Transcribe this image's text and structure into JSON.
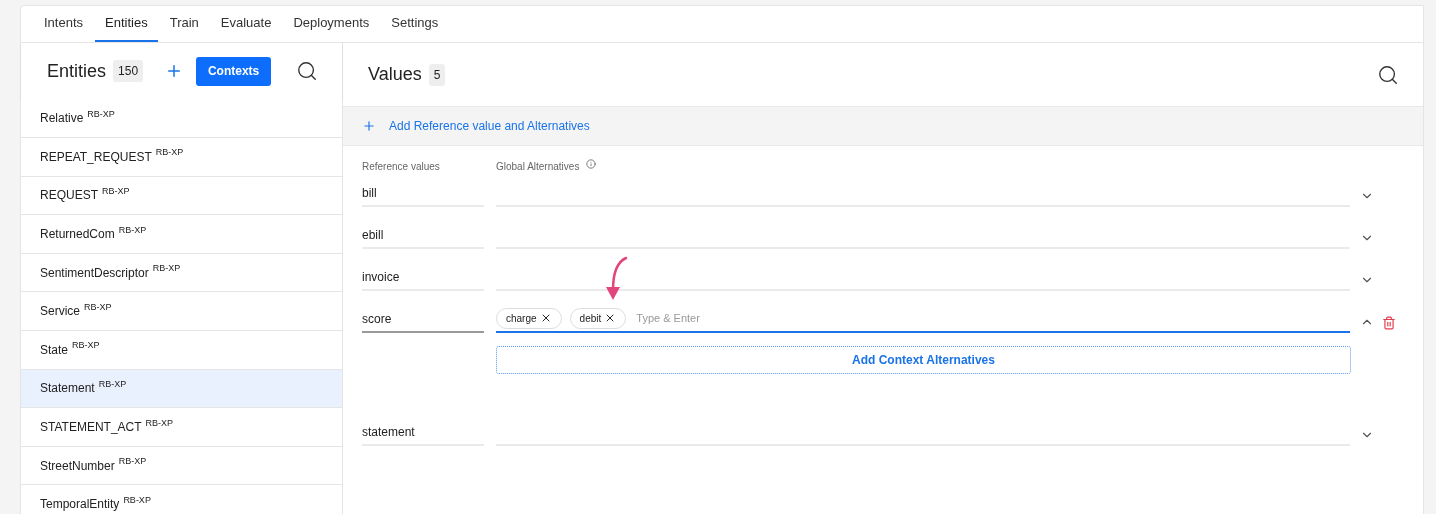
{
  "tabs": [
    {
      "label": "Intents",
      "selected": false
    },
    {
      "label": "Entities",
      "selected": true
    },
    {
      "label": "Train",
      "selected": false
    },
    {
      "label": "Evaluate",
      "selected": false
    },
    {
      "label": "Deployments",
      "selected": false
    },
    {
      "label": "Settings",
      "selected": false
    }
  ],
  "entities": {
    "title": "Entities",
    "count": "150",
    "contexts_button": "Contexts",
    "items": [
      {
        "name": "Relative",
        "tag": "RB-XP",
        "selected": false
      },
      {
        "name": "REPEAT_REQUEST",
        "tag": "RB-XP",
        "selected": false
      },
      {
        "name": "REQUEST",
        "tag": "RB-XP",
        "selected": false
      },
      {
        "name": "ReturnedCom",
        "tag": "RB-XP",
        "selected": false
      },
      {
        "name": "SentimentDescriptor",
        "tag": "RB-XP",
        "selected": false
      },
      {
        "name": "Service",
        "tag": "RB-XP",
        "selected": false
      },
      {
        "name": "State",
        "tag": "RB-XP",
        "selected": false
      },
      {
        "name": "Statement",
        "tag": "RB-XP",
        "selected": true
      },
      {
        "name": "STATEMENT_ACT",
        "tag": "RB-XP",
        "selected": false
      },
      {
        "name": "StreetNumber",
        "tag": "RB-XP",
        "selected": false
      },
      {
        "name": "TemporalEntity",
        "tag": "RB-XP",
        "selected": false
      }
    ]
  },
  "values": {
    "title": "Values",
    "count": "5",
    "add_label": "Add Reference value and Alternatives",
    "columns": {
      "reference": "Reference values",
      "global": "Global Alternatives"
    },
    "rows": [
      {
        "value": "bill",
        "expanded": false,
        "alternatives": []
      },
      {
        "value": "ebill",
        "expanded": false,
        "alternatives": []
      },
      {
        "value": "invoice",
        "expanded": false,
        "alternatives": []
      },
      {
        "value": "score",
        "expanded": true,
        "alternatives": [
          "charge",
          "debit"
        ],
        "placeholder": "Type & Enter",
        "context_button": "Add Context Alternatives"
      },
      {
        "value": "statement",
        "expanded": false,
        "alternatives": []
      }
    ]
  }
}
